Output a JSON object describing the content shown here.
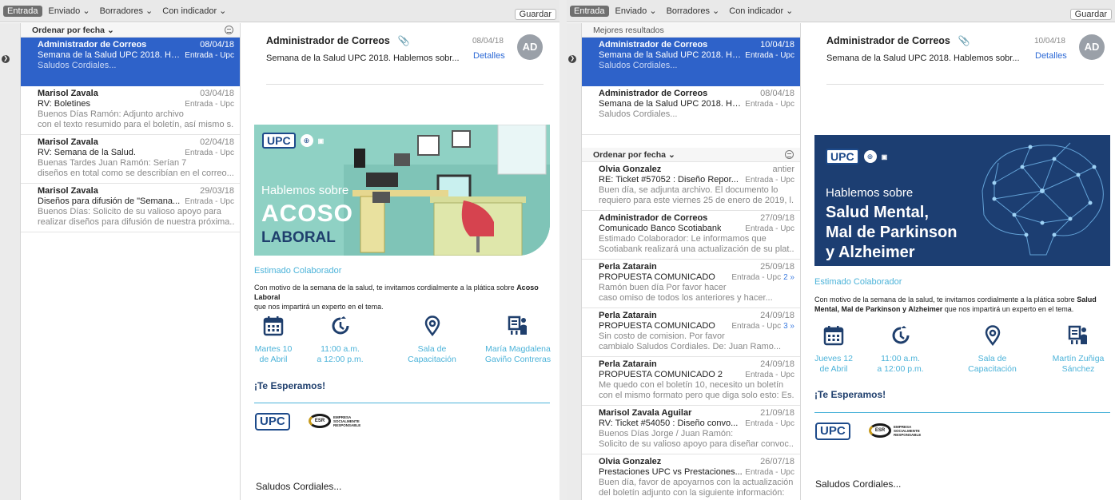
{
  "toolbar": {
    "inbox": "Entrada",
    "sent": "Enviado ⌄",
    "drafts": "Borradores ⌄",
    "flagged": "Con indicador ⌄",
    "save": "Guardar"
  },
  "left": {
    "list_header": "Ordenar por fecha ⌄",
    "messages": [
      {
        "sender": "Administrador de Correos",
        "date": "08/04/18",
        "subject": "Semana de la Salud UPC 2018. Ha...",
        "mailbox": "Entrada - Upc",
        "preview1": "Saludos Cordiales...",
        "preview2": ""
      },
      {
        "sender": "Marisol Zavala",
        "date": "03/04/18",
        "subject": "RV: Boletines",
        "mailbox": "Entrada - Upc",
        "preview1": "Buenos Días Ramón:               Adjunto archivo",
        "preview2": "con el texto resumido para el boletín, así mismo s..."
      },
      {
        "sender": "Marisol Zavala",
        "date": "02/04/18",
        "subject": "RV: Semana de la Salud.",
        "mailbox": "Entrada - Upc",
        "preview1": "Buenas Tardes Juan Ramón:              Serían 7",
        "preview2": "diseños en total como se describían en el correo..."
      },
      {
        "sender": "Marisol Zavala",
        "date": "29/03/18",
        "subject": "Diseños para difusión de \"Semana...",
        "mailbox": "Entrada - Upc",
        "preview1": "Buenos Días: Solicito de su valioso apoyo para",
        "preview2": "realizar diseños para difusión de nuestra próxima..."
      }
    ],
    "reader": {
      "from": "Administrador de Correos",
      "clip": "📎",
      "subject": "Semana de la Salud UPC 2018. Hablemos sobr...",
      "date": "08/04/18",
      "details": "Detalles",
      "avatar": "AD",
      "banner_logo": "UPC",
      "banner_intro": "Hablemos sobre",
      "banner_big1": "ACOSO",
      "banner_big2": "LABORAL",
      "estimado": "Estimado Colaborador",
      "invite_pre": "Con motivo de la semana de la salud, te invitamos cordialmente a la plática sobre ",
      "invite_topic": "Acoso Laboral",
      "invite_post": "que nos impartirá un experto en el tema.",
      "info": [
        {
          "icon": "calendar-icon",
          "text": "Martes 10\nde Abril"
        },
        {
          "icon": "clock-icon",
          "text": "11:00 a.m.\na 12:00 p.m."
        },
        {
          "icon": "location-pin-icon",
          "text": "Sala de\nCapacitación"
        },
        {
          "icon": "speaker-presentation-icon",
          "text": "María Magdalena\nGaviño Contreras"
        }
      ],
      "esperamos": "¡Te Esperamos!",
      "footer_upc": "UPC",
      "esr": "ESR",
      "esr_text": "EMPRESA SOCIALMENTE RESPONSABLE",
      "saludos": "Saludos Cordiales..."
    }
  },
  "right": {
    "best_header": "Mejores resultados",
    "best": [
      {
        "sender": "Administrador de Correos",
        "date": "10/04/18",
        "subject": "Semana de la Salud UPC 2018. Ha...",
        "mailbox": "Entrada - Upc",
        "preview1": "Saludos Cordiales..."
      },
      {
        "sender": "Administrador de Correos",
        "date": "08/04/18",
        "subject": "Semana de la Salud UPC 2018. Ha...",
        "mailbox": "Entrada - Upc",
        "preview1": "Saludos Cordiales..."
      }
    ],
    "list_header": "Ordenar por fecha ⌄",
    "messages": [
      {
        "sender": "Olvia Gonzalez",
        "date": "antier",
        "subject": "RE: Ticket #57052 : Diseño Repor...",
        "mailbox": "Entrada - Upc",
        "count": "",
        "preview1": "Buen día, se adjunta archivo. El  documento lo",
        "preview2": "requiero para este viernes 25 de enero de 2019, l..."
      },
      {
        "sender": "Administrador de Correos",
        "date": "27/09/18",
        "subject": "Comunicado Banco Scotiabank",
        "mailbox": "Entrada - Upc",
        "count": "",
        "preview1": "Estimado Colaborador: Le informamos que",
        "preview2": "Scotiabank realizará una actualización de su plat..."
      },
      {
        "sender": "Perla Zatarain",
        "date": "25/09/18",
        "subject": "PROPUESTA COMUNICADO",
        "mailbox": "Entrada - Upc",
        "count": "2 »",
        "preview1": "Ramón buen día              Por favor hacer",
        "preview2": "caso omiso de todos los anteriores y hacer..."
      },
      {
        "sender": "Perla Zatarain",
        "date": "24/09/18",
        "subject": "PROPUESTA COMUNICADO",
        "mailbox": "Entrada - Upc",
        "count": "3 »",
        "preview1": "Sin costo de comision. Por favor",
        "preview2": "cambialo Saludos Cordiales. De: Juan Ramo..."
      },
      {
        "sender": "Perla Zatarain",
        "date": "24/09/18",
        "subject": "PROPUESTA COMUNICADO 2",
        "mailbox": "Entrada - Upc",
        "count": "",
        "preview1": "Me quedo con el boletín 10, necesito un boletín",
        "preview2": "con el mismo formato pero que diga solo esto: Es..."
      },
      {
        "sender": "Marisol Zavala Aguilar",
        "date": "21/09/18",
        "subject": "RV: Ticket #54050 : Diseño convo...",
        "mailbox": "Entrada - Upc",
        "count": "",
        "preview1": "Buenos Días Jorge / Juan Ramón:",
        "preview2": "Solicito de su valioso apoyo para diseñar convoc..."
      },
      {
        "sender": "Olvia Gonzalez",
        "date": "26/07/18",
        "subject": "Prestaciones UPC vs Prestaciones...",
        "mailbox": "Entrada - Upc",
        "count": "",
        "preview1": "Buen día, favor de apoyarnos con la actualización",
        "preview2": "del boletín adjunto con la siguiente información:"
      }
    ],
    "reader": {
      "from": "Administrador de Correos",
      "clip": "📎",
      "subject": "Semana de la Salud UPC 2018. Hablemos sobr...",
      "date": "10/04/18",
      "details": "Detalles",
      "avatar": "AD",
      "banner_logo": "UPC",
      "banner_intro": "Hablemos sobre",
      "banner_big1": "Salud Mental,",
      "banner_big2": "Mal de Parkinson",
      "banner_big3": "y Alzheimer",
      "estimado": "Estimado Colaborador",
      "invite_pre": "Con motivo de la semana de la salud, te invitamos cordialmente a la plática sobre ",
      "invite_topic": "Salud Mental, Mal de Parkinson y Alzheimer",
      "invite_post": " que nos impartirá un experto en el tema.",
      "info": [
        {
          "icon": "calendar-icon",
          "text": "Jueves 12\nde Abril"
        },
        {
          "icon": "clock-icon",
          "text": "11:00 a.m.\na 12:00 p.m."
        },
        {
          "icon": "location-pin-icon",
          "text": "Sala de\nCapacitación"
        },
        {
          "icon": "speaker-presentation-icon",
          "text": "Martín Zuñiga\nSánchez"
        }
      ],
      "esperamos": "¡Te Esperamos!",
      "footer_upc": "UPC",
      "esr": "ESR",
      "esr_text": "EMPRESA SOCIALMENTE RESPONSABLE",
      "saludos": "Saludos Cordiales..."
    }
  },
  "colors": {
    "selection": "#2e62c9",
    "accent_teal": "#4cb3d9",
    "navy": "#1f3f6d",
    "banner_left_bg": "#8fd1c4",
    "banner_right_bg": "#1c3e72"
  }
}
